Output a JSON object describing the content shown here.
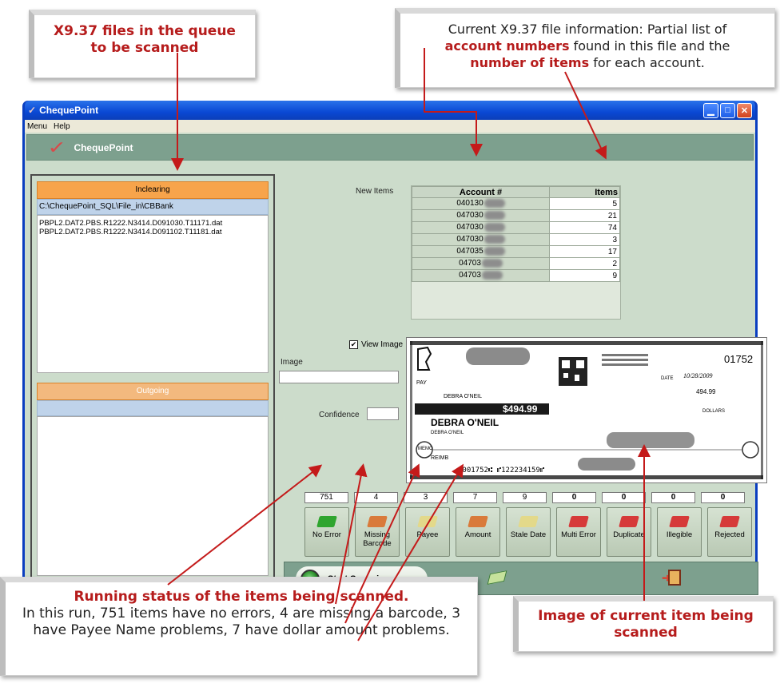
{
  "window": {
    "title": "ChequePoint",
    "menu": [
      "Menu",
      "Help"
    ],
    "banner_title": "ChequePoint"
  },
  "incoming": {
    "header": "Inclearing",
    "path": "C:\\ChequePoint_SQL\\File_in\\CBBank",
    "files": [
      "PBPL2.DAT2.PBS.R1222.N3414.D091030.T11171.dat",
      "PBPL2.DAT2.PBS.R1222.N3414.D091102.T11181.dat"
    ]
  },
  "outgoing": {
    "header": "Outgoing"
  },
  "new_items_label": "New Items",
  "accounts": {
    "headers": {
      "account": "Account #",
      "items": "Items"
    },
    "rows": [
      {
        "account": "040130",
        "items": "5"
      },
      {
        "account": "047030",
        "items": "21"
      },
      {
        "account": "047030",
        "items": "74"
      },
      {
        "account": "047030",
        "items": "3"
      },
      {
        "account": "047035",
        "items": "17"
      },
      {
        "account": "04703",
        "items": "2"
      },
      {
        "account": "04703",
        "items": "9"
      }
    ]
  },
  "image_panel": {
    "view_image_label": "View Image",
    "view_image_checked": "✔",
    "image_label": "Image",
    "confidence_label": "Confidence"
  },
  "cheque": {
    "number": "01752",
    "date_label": "DATE",
    "date": "10/28/2009",
    "pay_label": "PAY",
    "payee_short": "DEBRA O'NEIL",
    "amount": "494.99",
    "amount_box": "$494.99",
    "payee": "DEBRA O'NEIL",
    "payee_sub": "DEBRA O'NEIL",
    "dollars": "DOLLARS",
    "memo_label": "MEMO",
    "memo": "REIMB",
    "micr": "⑆001752⑆ ⑈122234159⑈"
  },
  "status": {
    "counts": [
      "751",
      "4",
      "3",
      "7",
      "9",
      "0",
      "0",
      "0",
      "0"
    ],
    "buttons": [
      {
        "label": "No Error",
        "color": "#2fa52f"
      },
      {
        "label": "Missing Barcode",
        "color": "#d97a3a"
      },
      {
        "label": "Payee",
        "color": "#e3d98a"
      },
      {
        "label": "Amount",
        "color": "#d97a3a"
      },
      {
        "label": "Stale Date",
        "color": "#e3d98a"
      },
      {
        "label": "Multi Error",
        "color": "#d63a3a"
      },
      {
        "label": "Duplicate",
        "color": "#d63a3a"
      },
      {
        "label": "Illegible",
        "color": "#d63a3a"
      },
      {
        "label": "Rejected",
        "color": "#d63a3a"
      }
    ]
  },
  "footer": {
    "start_label": "Start Scanning"
  },
  "callouts": {
    "queue": {
      "line1": "X9.37 files in the queue",
      "line2": "to be scanned"
    },
    "fileinfo": {
      "text1": "Current X9.37 file information: Partial list of",
      "hl1": "account numbers",
      "text2": " found in this file and the",
      "hl2": "number of items",
      "text3": " for each account."
    },
    "status": {
      "title": "Running status of the items being scanned.",
      "body": "In this run, 751 items have no errors, 4 are missing a barcode, 3 have Payee Name problems, 7 have dollar amount problems."
    },
    "image": {
      "line1": "Image of current item being",
      "line2": "scanned"
    }
  }
}
